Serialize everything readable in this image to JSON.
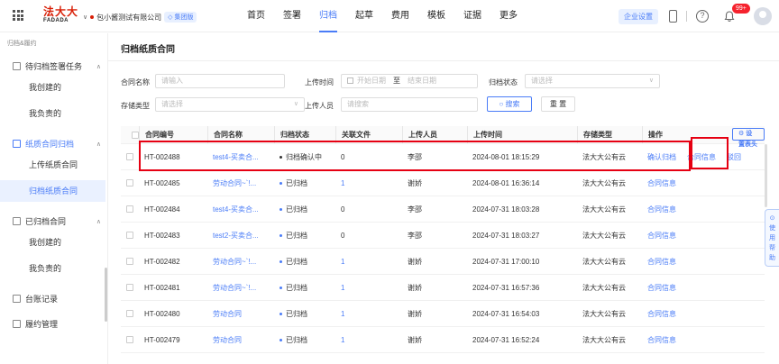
{
  "header": {
    "logo_cn": "法大大",
    "logo_en": "FADADA",
    "company": "包小酱测试有限公司",
    "company_badge": "集团版",
    "nav": [
      "首页",
      "签署",
      "归档",
      "起草",
      "费用",
      "模板",
      "证据",
      "更多"
    ],
    "active_nav_index": 2,
    "enterprise_settings": "企业设置",
    "notification_count": "99+",
    "help_glyph": "?"
  },
  "sidebar": {
    "breadcrumb": "归档&履约",
    "groups": [
      {
        "label": "待归档签署任务",
        "items": [
          "我创建的",
          "我负责的"
        ]
      },
      {
        "label": "纸质合同归档",
        "items": [
          "上传纸质合同",
          "归档纸质合同"
        ]
      },
      {
        "label": "已归档合同",
        "items": [
          "我创建的",
          "我负责的"
        ]
      },
      {
        "label": "台账记录",
        "items": []
      },
      {
        "label": "履约管理",
        "items": []
      }
    ],
    "active_item": "归档纸质合同"
  },
  "main": {
    "title": "归档纸质合同",
    "filters": {
      "contract_name_label": "合同名称",
      "contract_name_placeholder": "请输入",
      "upload_time_label": "上传时间",
      "start_date_placeholder": "开始日期",
      "to_label": "至",
      "end_date_placeholder": "结束日期",
      "archive_status_label": "归档状态",
      "archive_status_placeholder": "请选择",
      "storage_type_label": "存储类型",
      "storage_type_placeholder": "请选择",
      "uploader_label": "上传人员",
      "uploader_placeholder": "请搜索",
      "search_button": "搜索",
      "reset_button": "重 置"
    },
    "table": {
      "settings_button": "设置表头",
      "columns": [
        "合同编号",
        "合同名称",
        "归档状态",
        "关联文件",
        "上传人员",
        "上传时间",
        "存储类型",
        "操作"
      ],
      "rows": [
        {
          "id": "HT-002488",
          "name": "test4-买卖合...",
          "status": "归档确认中",
          "files": "0",
          "uploader": "李邵",
          "time": "2024-08-01 18:15:29",
          "storage": "法大大公有云",
          "actions": [
            "确认归档",
            "合同信息",
            "驳回"
          ]
        },
        {
          "id": "HT-002485",
          "name": "劳动合同~`!...",
          "status": "已归档",
          "files": "1",
          "uploader": "谢娇",
          "time": "2024-08-01 16:36:14",
          "storage": "法大大公有云",
          "actions": [
            "合同信息"
          ]
        },
        {
          "id": "HT-002484",
          "name": "test4-买卖合...",
          "status": "已归档",
          "files": "0",
          "uploader": "李邵",
          "time": "2024-07-31 18:03:28",
          "storage": "法大大公有云",
          "actions": [
            "合同信息"
          ]
        },
        {
          "id": "HT-002483",
          "name": "test2-买卖合...",
          "status": "已归档",
          "files": "0",
          "uploader": "李邵",
          "time": "2024-07-31 18:03:27",
          "storage": "法大大公有云",
          "actions": [
            "合同信息"
          ]
        },
        {
          "id": "HT-002482",
          "name": "劳动合同~`!...",
          "status": "已归档",
          "files": "1",
          "uploader": "谢娇",
          "time": "2024-07-31 17:00:10",
          "storage": "法大大公有云",
          "actions": [
            "合同信息"
          ]
        },
        {
          "id": "HT-002481",
          "name": "劳动合同~`!...",
          "status": "已归档",
          "files": "1",
          "uploader": "谢娇",
          "time": "2024-07-31 16:57:36",
          "storage": "法大大公有云",
          "actions": [
            "合同信息"
          ]
        },
        {
          "id": "HT-002480",
          "name": "劳动合同",
          "status": "已归档",
          "files": "1",
          "uploader": "谢娇",
          "time": "2024-07-31 16:54:03",
          "storage": "法大大公有云",
          "actions": [
            "合同信息"
          ]
        },
        {
          "id": "HT-002479",
          "name": "劳动合同",
          "status": "已归档",
          "files": "1",
          "uploader": "谢娇",
          "time": "2024-07-31 16:52:24",
          "storage": "法大大公有云",
          "actions": [
            "合同信息"
          ]
        }
      ]
    }
  },
  "floating_tab": "使用帮助",
  "colors": {
    "accent": "#4a7cf7",
    "brand_red": "#d81e06",
    "highlight_box": "#e60012",
    "badge_red": "#f5222d"
  }
}
